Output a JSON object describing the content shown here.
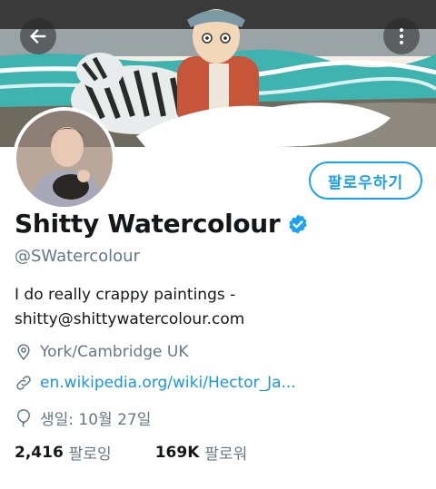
{
  "profile": {
    "display_name": "Shitty Watercolour",
    "handle": "@SWatercolour",
    "bio_line1": "I do really crappy paintings -",
    "bio_line2": "shitty@shittywatercolour.com",
    "location": "York/Cambridge UK",
    "website": "en.wikipedia.org/wiki/Hector_Ja...",
    "birthday": "생일: 10월 27일",
    "following_count": "2,416",
    "following_label": "팔로잉",
    "followers_count": "169K",
    "followers_label": "팔로워"
  },
  "actions": {
    "follow_label": "팔로우하기"
  },
  "icons": {
    "back": "back-arrow-icon",
    "more": "more-vertical-icon",
    "verified": "verified-badge-icon",
    "location": "location-pin-icon",
    "link": "link-icon",
    "birthday": "balloon-icon"
  },
  "colors": {
    "accent": "#1da1f2",
    "link": "#1b95e0",
    "secondary_text": "#657786",
    "primary_text": "#14171a"
  }
}
